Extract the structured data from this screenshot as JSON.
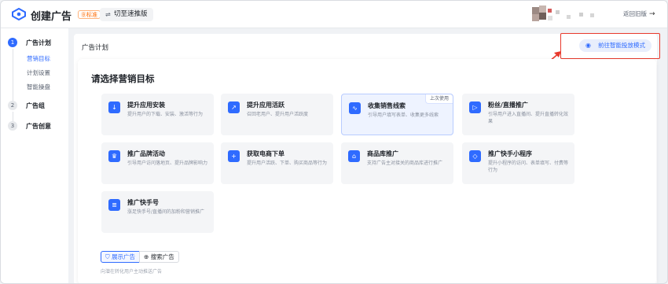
{
  "topbar": {
    "app_title": "创建广告",
    "badge": "Ⓑ标准",
    "switch_label": "切至速推版",
    "switch_icon": "switch-icon",
    "back_label": "返回旧版",
    "back_icon": "arrow-right-icon"
  },
  "sidebar": {
    "steps": [
      {
        "num": "1",
        "label": "广告计划",
        "active": true
      },
      {
        "num": "2",
        "label": "广告组",
        "active": false
      },
      {
        "num": "3",
        "label": "广告创意",
        "active": false
      }
    ],
    "substeps": [
      {
        "label": "营销目标",
        "active": true
      },
      {
        "label": "计划设置",
        "active": false
      },
      {
        "label": "智能操盘",
        "active": false
      }
    ]
  },
  "panel": {
    "title": "广告计划",
    "smart_button": "前往智能投放模式",
    "smart_icon": "eye-icon"
  },
  "section": {
    "title": "请选择营销目标"
  },
  "goals": [
    {
      "name": "提升应用安装",
      "desc": "提升用户的下载、安装、激活等行为",
      "icon": "download-icon",
      "selected": false,
      "tag": ""
    },
    {
      "name": "提升应用活跃",
      "desc": "召回老用户、提升用户活跃度",
      "icon": "trend-up-icon",
      "selected": false,
      "tag": ""
    },
    {
      "name": "收集销售线索",
      "desc": "引导用户填写表单、收集更多线索",
      "icon": "lead-icon",
      "selected": true,
      "tag": "上次使用"
    },
    {
      "name": "粉丝/直播推广",
      "desc": "引导用户进入直播间、提升直播转化效果",
      "icon": "live-icon",
      "selected": false,
      "tag": ""
    },
    {
      "name": "推广品牌活动",
      "desc": "引导用户访问落地页、提升品牌影响力",
      "icon": "brand-icon",
      "selected": false,
      "tag": ""
    },
    {
      "name": "获取电商下单",
      "desc": "提升用户活跃、下单、购买商品等行为",
      "icon": "cart-icon",
      "selected": false,
      "tag": ""
    },
    {
      "name": "商品库推广",
      "desc": "支持广告主对接关的商品库进行推广",
      "icon": "store-icon",
      "selected": false,
      "tag": ""
    },
    {
      "name": "推广快手小程序",
      "desc": "提升小程序的访问、表单填写、付费等行为",
      "icon": "miniapp-icon",
      "selected": false,
      "tag": ""
    },
    {
      "name": "推广快手号",
      "desc": "涨足快手号/直播间的加粉和营销推广",
      "icon": "account-icon",
      "selected": false,
      "tag": ""
    }
  ],
  "tabs": [
    {
      "label": "展示广告",
      "icon": "display-icon",
      "active": true
    },
    {
      "label": "搜索广告",
      "icon": "search-icon",
      "active": false
    }
  ],
  "tab_desc": "向潜在转化用户主动推送广告",
  "colors": {
    "accent": "#2f6bff",
    "highlight": "#e8392c"
  }
}
